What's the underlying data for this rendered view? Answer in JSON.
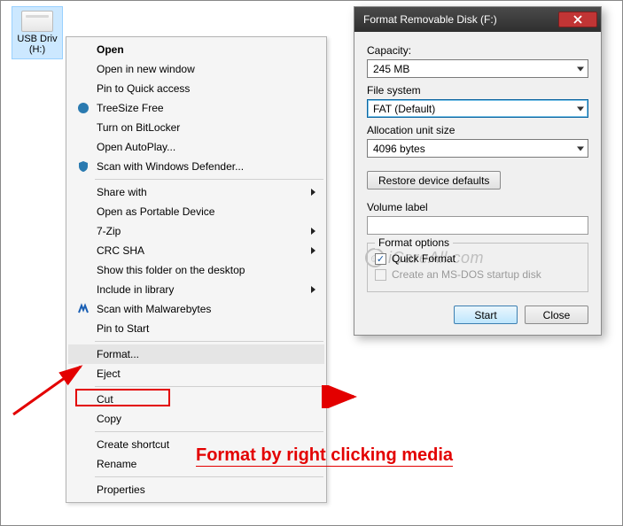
{
  "desktop": {
    "icon_label_line1": "USB Driv",
    "icon_label_line2": "(H:)"
  },
  "context_menu": {
    "open": "Open",
    "open_new_window": "Open in new window",
    "pin_quick_access": "Pin to Quick access",
    "treesize": "TreeSize Free",
    "bitlocker": "Turn on BitLocker",
    "autoplay": "Open AutoPlay...",
    "defender": "Scan with Windows Defender...",
    "share_with": "Share with",
    "portable_device": "Open as Portable Device",
    "seven_zip": "7-Zip",
    "crc_sha": "CRC SHA",
    "show_folder_desktop": "Show this folder on the desktop",
    "include_library": "Include in library",
    "malwarebytes": "Scan with Malwarebytes",
    "pin_start": "Pin to Start",
    "format": "Format...",
    "eject": "Eject",
    "cut": "Cut",
    "copy": "Copy",
    "create_shortcut": "Create shortcut",
    "rename": "Rename",
    "properties": "Properties"
  },
  "dialog": {
    "title": "Format Removable Disk (F:)",
    "capacity_label": "Capacity:",
    "capacity_value": "245 MB",
    "filesystem_label": "File system",
    "filesystem_value": "FAT (Default)",
    "alloc_label": "Allocation unit size",
    "alloc_value": "4096 bytes",
    "restore_defaults": "Restore device defaults",
    "volume_label": "Volume label",
    "format_options": "Format options",
    "quick_format": "Quick Format",
    "msdos": "Create an MS-DOS startup disk",
    "start": "Start",
    "close": "Close"
  },
  "watermark": "iCareAll.com",
  "annotation": "Format by right clicking media"
}
